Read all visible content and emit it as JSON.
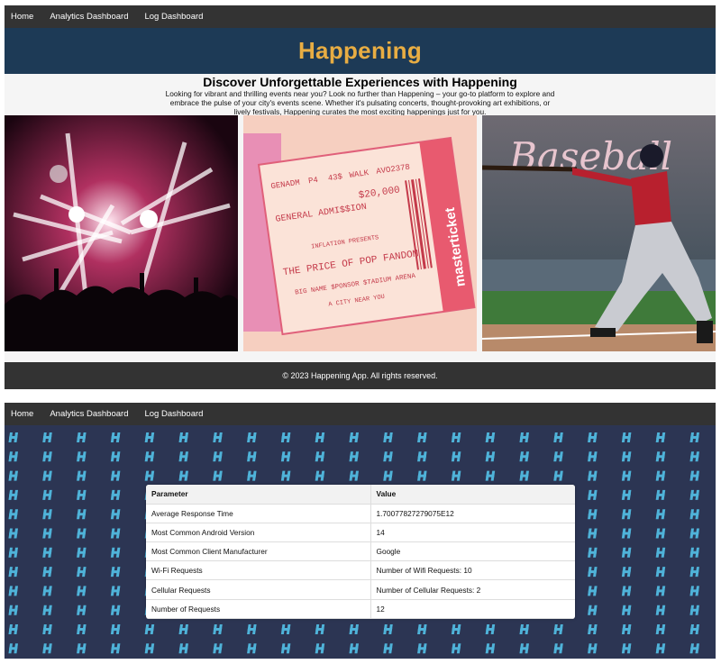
{
  "nav": {
    "items": [
      {
        "label": "Home"
      },
      {
        "label": "Analytics Dashboard"
      },
      {
        "label": "Log Dashboard"
      }
    ]
  },
  "hero": {
    "title": "Happening",
    "title_color": "#e8ad43",
    "bg_color": "#1d3a56"
  },
  "intro": {
    "heading": "Discover Unforgettable Experiences with Happening",
    "body": "Looking for vibrant and thrilling events near you? Look no further than Happening – your go-to platform to explore and embrace the pulse of your city's events scene. Whether it's pulsating concerts, thought-provoking art exhibitions, or lively festivals, Happening curates the most exciting happenings just for you."
  },
  "images": [
    {
      "icon": "concert-image"
    },
    {
      "icon": "ticket-image",
      "ticket_texts": {
        "admission": "GENERAL ADMI$$ION",
        "price": "$20,000",
        "presents": "INFLATION PRESENTS",
        "title": "THE PRICE OF POP FANDOM",
        "venue": "BIG NAME $PONSOR $TADIUM ARENA",
        "city": "A CITY NEAR YOU",
        "brand": "masterticket",
        "gen": "GENADM",
        "p4": "P4",
        "seat": "43$",
        "walk": "WALK",
        "code": "AVO2378"
      }
    },
    {
      "icon": "baseball-image",
      "sign_text": "Baseball"
    }
  ],
  "footer": {
    "text": "© 2023 Happening App. All rights reserved."
  },
  "analytics": {
    "columns": [
      "Parameter",
      "Value"
    ],
    "rows": [
      [
        "Average Response Time",
        "1.70077827279075E12"
      ],
      [
        "Most Common Android Version",
        "14"
      ],
      [
        "Most Common Client Manufacturer",
        "Google"
      ],
      [
        "Wi-Fi Requests",
        "Number of Wifi Requests: 10"
      ],
      [
        "Cellular Requests",
        "Number of Cellular Requests: 2"
      ],
      [
        "Number of Requests",
        "12"
      ]
    ],
    "pattern_bg": "#2c3553",
    "pattern_glyph_color": "#4fb3d9"
  }
}
